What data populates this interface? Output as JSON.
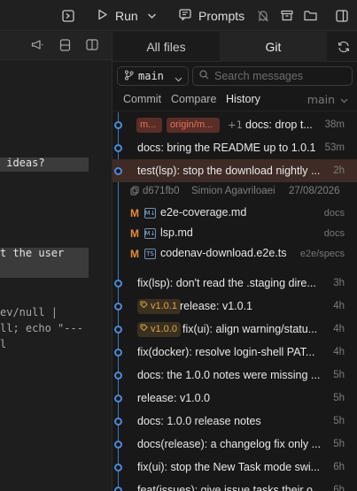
{
  "toolbar": {
    "run_label": "Run",
    "prompts_label": "Prompts",
    "icons": [
      "terminal-icon",
      "play-icon",
      "chevron-down-icon",
      "prompts-icon",
      "ghost-off-icon",
      "archive-icon",
      "folder-icon",
      "panel-toggle-icon"
    ]
  },
  "editor": {
    "lines": [
      {
        "text": " ideas?",
        "highlight": true
      },
      {
        "text": "t the user",
        "highlight": true
      },
      {
        "text": "ev/null |",
        "highlight": false
      },
      {
        "text": "ll; echo \"---",
        "highlight": false
      },
      {
        "text": "l",
        "highlight": false
      }
    ]
  },
  "panel": {
    "tabs": {
      "files": "All files",
      "git": "Git"
    },
    "branch": "main",
    "search_placeholder": "Search messages",
    "subtabs": {
      "commit": "Commit",
      "compare": "Compare",
      "history": "History",
      "branch": "main"
    },
    "commits": [
      {
        "chip1": "m...",
        "chip2": "origin/m...",
        "plus": "+1",
        "message": "docs: drop t...",
        "time": "38m"
      },
      {
        "message": "docs: bring the README up to 1.0.1",
        "time": "53m"
      },
      {
        "message": "test(lsp): stop the download nightly ...",
        "time": "2h"
      }
    ],
    "selected_meta": {
      "hash": "d671fb0",
      "author": "Simion Agavriloaei",
      "date": "27/08/2026"
    },
    "files": [
      {
        "status": "M",
        "type": "md",
        "name": "e2e-coverage.md",
        "dir": "docs"
      },
      {
        "status": "M",
        "type": "md",
        "name": "lsp.md",
        "dir": "docs"
      },
      {
        "status": "M",
        "type": "ts",
        "name": "codenav-download.e2e.ts",
        "dir": "e2e/specs"
      }
    ],
    "commits_after": [
      {
        "message": "fix(lsp): don't read the .staging dire...",
        "time": "3h"
      },
      {
        "tag": "v1.0.1",
        "message": "release: v1.0.1",
        "time": "4h"
      },
      {
        "tag": "v1.0.0",
        "message": "fix(ui): align warning/statu...",
        "time": "4h"
      },
      {
        "message": "fix(docker): resolve login-shell PAT...",
        "time": "4h"
      },
      {
        "message": "docs: the 1.0.0 notes were missing ...",
        "time": "5h"
      },
      {
        "message": "release: v1.0.0",
        "time": "5h"
      },
      {
        "message": "docs: 1.0.0 release notes",
        "time": "5h"
      },
      {
        "message": "docs(release): a changelog fix only ...",
        "time": "5h"
      },
      {
        "message": "fix(ui): stop the New Task mode swi...",
        "time": "6h"
      },
      {
        "message": "feat(issues): give issue tasks their o...",
        "time": "6h"
      }
    ]
  }
}
